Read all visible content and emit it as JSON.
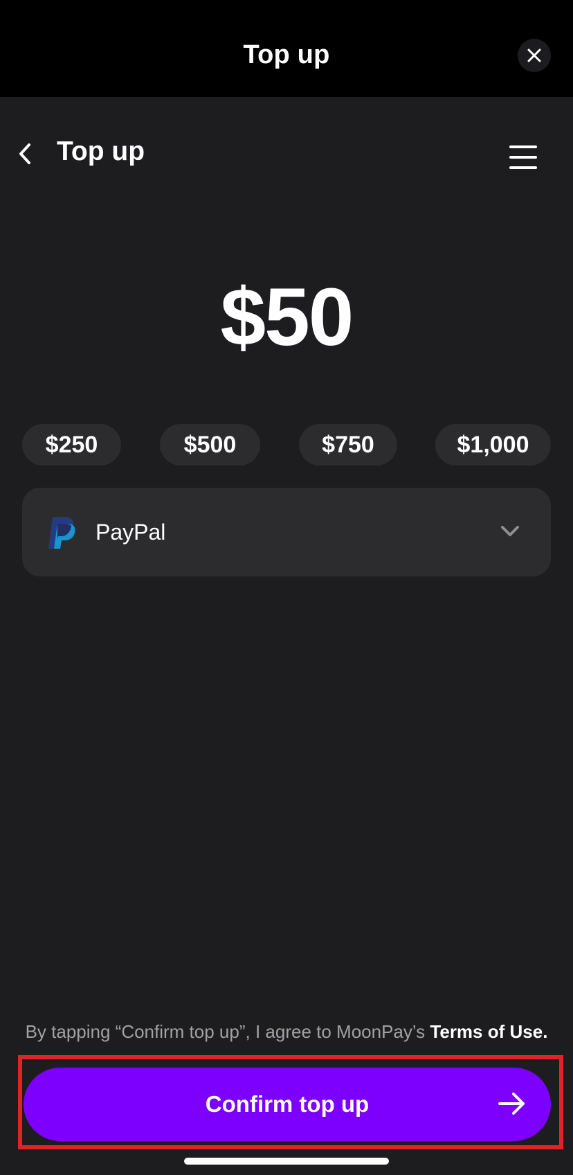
{
  "sheet": {
    "title": "Top up",
    "close_icon": "close-icon"
  },
  "app_bar": {
    "title": "Top up",
    "back_icon": "chevron-left-icon",
    "menu_icon": "hamburger-menu-icon"
  },
  "amount": {
    "value": "$50"
  },
  "quick_amounts": [
    "$250",
    "$500",
    "$750",
    "$1,000"
  ],
  "payment_method": {
    "label": "PayPal",
    "icon": "paypal-icon",
    "dropdown_icon": "chevron-down-icon"
  },
  "terms": {
    "prefix": "By tapping “Confirm top up”, I agree to MoonPay’s ",
    "link": "Terms of Use."
  },
  "confirm": {
    "label": "Confirm top up",
    "icon": "arrow-right-icon"
  },
  "colors": {
    "background": "#1d1d1f",
    "header": "#000000",
    "surface": "#2c2c2e",
    "accent": "#7d00ff",
    "highlight": "#e02424"
  }
}
